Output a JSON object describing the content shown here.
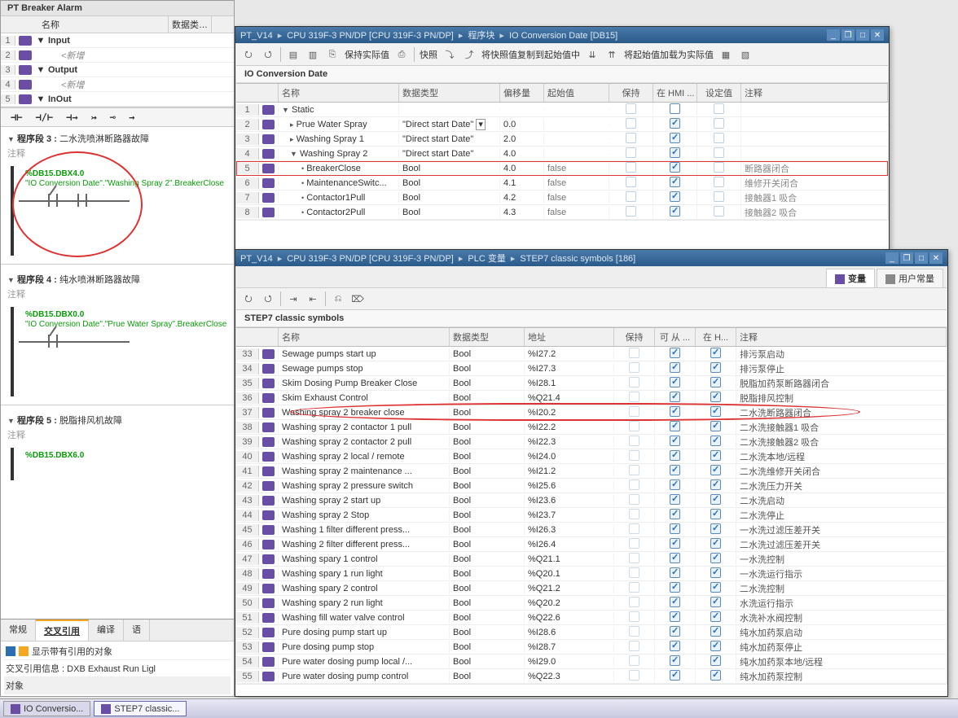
{
  "left": {
    "title": "PT Breaker Alarm",
    "header_name": "名称",
    "header_data": "数据类…",
    "rows": [
      {
        "n": "1",
        "arr": "▼",
        "txt": "Input",
        "bold": true
      },
      {
        "n": "2",
        "arr": "",
        "txt": "<新增",
        "ital": true,
        "pad": 1
      },
      {
        "n": "3",
        "arr": "▼",
        "txt": "Output",
        "bold": true
      },
      {
        "n": "4",
        "arr": "",
        "txt": "<新增",
        "ital": true,
        "pad": 1
      },
      {
        "n": "5",
        "arr": "▼",
        "txt": "InOut",
        "bold": true
      }
    ],
    "lad_buttons": [
      "⊣⊢",
      "⊣/⊢",
      "⊣→",
      "↣",
      "⊸",
      "→"
    ],
    "seg3": {
      "title": "程序段 3 :",
      "text": "二水洗喷淋断路器故障",
      "comment": "注释",
      "tag": "%DB15.DBX4.0",
      "sym": "\"IO Conversion Date\".\"Washing Spray 2\".BreakerClose"
    },
    "seg4": {
      "title": "程序段 4 :",
      "text": "纯水喷淋断路器故障",
      "comment": "注释",
      "tag": "%DB15.DBX0.0",
      "sym": "\"IO Conversion Date\".\"Prue Water Spray\".BreakerClose"
    },
    "seg5": {
      "title": "程序段 5 :",
      "text": "脱脂排风机故障",
      "comment": "注释",
      "tag": "%DB15.DBX6.0"
    },
    "xref": {
      "tabs": [
        "常规",
        "交叉引用",
        "编译",
        "语"
      ],
      "row1": "显示带有引用的对象",
      "row2": "交叉引用信息 : DXB Exhaust Run Ligl",
      "row3": "对象"
    }
  },
  "win1": {
    "crumbs": [
      "PT_V14",
      "CPU 319F-3 PN/DP [CPU 319F-3 PN/DP]",
      "程序块",
      "IO Conversion Date [DB15]"
    ],
    "tb": [
      "保持实际值",
      "快照",
      "将快照值复制到起始值中",
      "将起始值加载为实际值"
    ],
    "subtitle": "IO Conversion Date",
    "head": [
      "名称",
      "数据类型",
      "偏移量",
      "起始值",
      "保持",
      "在 HMI ...",
      "设定值",
      "注释"
    ],
    "rows": [
      {
        "n": "1",
        "arr": "▼",
        "name": "Static",
        "type": "",
        "off": "",
        "init": "",
        "k": false,
        "h": false,
        "s": false,
        "c": ""
      },
      {
        "n": "2",
        "arr": "▸",
        "name": "Prue Water Spray",
        "type": "\"Direct start Date\"",
        "off": "0.0",
        "init": "",
        "k": false,
        "h": true,
        "s": true,
        "c": "",
        "i": 1,
        "tb": true
      },
      {
        "n": "3",
        "arr": "▸",
        "name": "Washing Spray 1",
        "type": "\"Direct start Date\"",
        "off": "2.0",
        "init": "",
        "k": false,
        "h": true,
        "s": true,
        "c": "",
        "i": 1
      },
      {
        "n": "4",
        "arr": "▼",
        "name": "Washing Spray 2",
        "type": "\"Direct start Date\"",
        "off": "4.0",
        "init": "",
        "k": false,
        "h": true,
        "s": true,
        "c": "",
        "i": 1
      },
      {
        "n": "5",
        "arr": "",
        "name": "BreakerClose",
        "type": "Bool",
        "off": "4.0",
        "init": "false",
        "k": false,
        "h": true,
        "s": true,
        "c": "断路器闭合",
        "i": 2,
        "hl": true
      },
      {
        "n": "6",
        "arr": "",
        "name": "MaintenanceSwitc...",
        "type": "Bool",
        "off": "4.1",
        "init": "false",
        "k": false,
        "h": true,
        "s": true,
        "c": "维修开关闭合",
        "i": 2
      },
      {
        "n": "7",
        "arr": "",
        "name": "Contactor1Pull",
        "type": "Bool",
        "off": "4.2",
        "init": "false",
        "k": false,
        "h": true,
        "s": true,
        "c": "接触器1 吸合",
        "i": 2
      },
      {
        "n": "8",
        "arr": "",
        "name": "Contactor2Pull",
        "type": "Bool",
        "off": "4.3",
        "init": "false",
        "k": false,
        "h": true,
        "s": true,
        "c": "接触器2 吸合",
        "i": 2
      }
    ]
  },
  "win2": {
    "crumbs": [
      "PT_V14",
      "CPU 319F-3 PN/DP [CPU 319F-3 PN/DP]",
      "PLC 变量",
      "STEP7 classic symbols [186]"
    ],
    "tabs": [
      "变量",
      "用户常量"
    ],
    "subtitle": "STEP7 classic symbols",
    "head": [
      "名称",
      "数据类型",
      "地址",
      "保持",
      "可 从 ...",
      "在 H...",
      "注释"
    ],
    "rows": [
      {
        "n": "33",
        "name": "Sewage pumps start up",
        "type": "Bool",
        "addr": "%I27.2",
        "c": "排污泵启动"
      },
      {
        "n": "34",
        "name": "Sewage pumps stop",
        "type": "Bool",
        "addr": "%I27.3",
        "c": "排污泵停止"
      },
      {
        "n": "35",
        "name": "Skim Dosing Pump Breaker Close",
        "type": "Bool",
        "addr": "%I28.1",
        "c": "脱脂加药泵断路器闭合"
      },
      {
        "n": "36",
        "name": "Skim Exhaust Control",
        "type": "Bool",
        "addr": "%Q21.4",
        "c": "脱脂排风控制"
      },
      {
        "n": "37",
        "name": "Washing spray 2 breaker close",
        "type": "Bool",
        "addr": "%I20.2",
        "c": "二水洗断路器闭合",
        "hl": true
      },
      {
        "n": "38",
        "name": "Washing spray 2 contactor 1 pull",
        "type": "Bool",
        "addr": "%I22.2",
        "c": "二水洗接触器1 吸合"
      },
      {
        "n": "39",
        "name": "Washing spray 2 contactor 2 pull",
        "type": "Bool",
        "addr": "%I22.3",
        "c": "二水洗接触器2 吸合"
      },
      {
        "n": "40",
        "name": "Washing spray 2 local / remote",
        "type": "Bool",
        "addr": "%I24.0",
        "c": "二水洗本地/远程"
      },
      {
        "n": "41",
        "name": "Washing spray 2 maintenance ...",
        "type": "Bool",
        "addr": "%I21.2",
        "c": "二水洗维修开关闭合"
      },
      {
        "n": "42",
        "name": "Washing spray 2 pressure switch",
        "type": "Bool",
        "addr": "%I25.6",
        "c": "二水洗压力开关"
      },
      {
        "n": "43",
        "name": "Washing spray 2 start up",
        "type": "Bool",
        "addr": "%I23.6",
        "c": "二水洗启动"
      },
      {
        "n": "44",
        "name": "Washing spray 2 Stop",
        "type": "Bool",
        "addr": "%I23.7",
        "c": "二水洗停止"
      },
      {
        "n": "45",
        "name": "Washing 1 filter different press...",
        "type": "Bool",
        "addr": "%I26.3",
        "c": "一水洗过滤压差开关"
      },
      {
        "n": "46",
        "name": "Washing 2 filter different press...",
        "type": "Bool",
        "addr": "%I26.4",
        "c": "二水洗过滤压差开关"
      },
      {
        "n": "47",
        "name": "Washing spary 1 control",
        "type": "Bool",
        "addr": "%Q21.1",
        "c": "一水洗控制"
      },
      {
        "n": "48",
        "name": "Washing spary 1 run light",
        "type": "Bool",
        "addr": "%Q20.1",
        "c": "一水洗运行指示"
      },
      {
        "n": "49",
        "name": "Washing spary 2 control",
        "type": "Bool",
        "addr": "%Q21.2",
        "c": "二水洗控制"
      },
      {
        "n": "50",
        "name": "Washing spary 2 run light",
        "type": "Bool",
        "addr": "%Q20.2",
        "c": "水洗运行指示"
      },
      {
        "n": "51",
        "name": "Washing fill water valve control",
        "type": "Bool",
        "addr": "%Q22.6",
        "c": "水洗补水阀控制"
      },
      {
        "n": "52",
        "name": "Pure dosing pump start up",
        "type": "Bool",
        "addr": "%I28.6",
        "c": "纯水加药泵启动"
      },
      {
        "n": "53",
        "name": "Pure dosing pump stop",
        "type": "Bool",
        "addr": "%I28.7",
        "c": "纯水加药泵停止"
      },
      {
        "n": "54",
        "name": "Pure water dosing pump local /...",
        "type": "Bool",
        "addr": "%I29.0",
        "c": "纯水加药泵本地/远程"
      },
      {
        "n": "55",
        "name": "Pure water dosing pump control",
        "type": "Bool",
        "addr": "%Q22.3",
        "c": "纯水加药泵控制"
      }
    ]
  },
  "taskbar": {
    "items": [
      {
        "t": "IO Conversio..."
      },
      {
        "t": "STEP7 classic...",
        "active": true
      }
    ]
  }
}
